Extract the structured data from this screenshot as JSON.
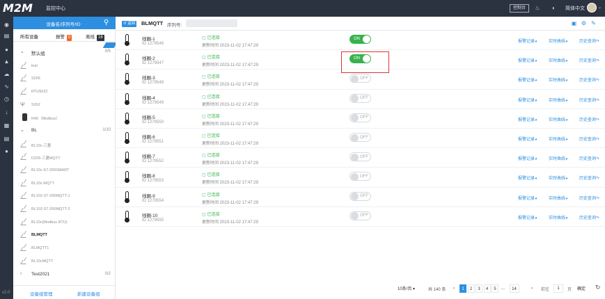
{
  "topbar": {
    "logo": "M2M",
    "title": "监控中心",
    "console_button": "控制台",
    "language": "简体中文"
  },
  "rail": {
    "icons": [
      "home-icon",
      "monitor-icon",
      "location-icon",
      "bell-icon",
      "cloud-icon",
      "signal-icon",
      "clock-icon",
      "download-icon",
      "calendar-icon",
      "list-icon",
      "user-icon"
    ],
    "version": "v2.0"
  },
  "devices": {
    "search_placeholder": "设备名/序列号/ID",
    "tabs": {
      "all": "所有设备",
      "alarm": "报警",
      "alarm_count": "0",
      "offline": "离线",
      "offline_count": "16"
    },
    "groups": [
      {
        "name": "默认组",
        "count": "0/5",
        "expanded": true,
        "items": [
          "test",
          "S265",
          "RTU5022",
          "S262",
          "R40（Modbus）"
        ]
      },
      {
        "name": "BL",
        "count": "1/10",
        "expanded": true,
        "items": [
          "BL10c-三菱",
          "D225-三菱MQTT",
          "BL10c-S7-200SMART",
          "BL10c-MQTT",
          "BL102-S7-200MQTT-1",
          "BL102-S7-200MQTT-2",
          "BL10c(Modbus RTU)",
          "BLMQTT",
          "BLMQTT1",
          "BL10cMQTT"
        ]
      },
      {
        "name": "Test2021",
        "count": "0/2",
        "expanded": false,
        "items": []
      }
    ],
    "active_item": "BLMQTT",
    "manage_groups": "设备组管理",
    "new_group": "新建设备组"
  },
  "main": {
    "back": "返回",
    "title": "BLMQTT",
    "serial_label": "序列号:",
    "status_text": "已连接",
    "time_text": "更新时间 2023-11-02 17:47:29",
    "links": {
      "alarm": "报警记录",
      "realtime": "实时曲线",
      "history": "历史查询"
    },
    "rows": [
      {
        "name": "线圈-1",
        "id": "ID 1279546",
        "state": "ON"
      },
      {
        "name": "线圈-2",
        "id": "ID 1279547",
        "state": "ON"
      },
      {
        "name": "线圈-3",
        "id": "ID 1279548",
        "state": "OFF"
      },
      {
        "name": "线圈-4",
        "id": "ID 1279549",
        "state": "OFF"
      },
      {
        "name": "线圈-5",
        "id": "ID 1279550",
        "state": "OFF"
      },
      {
        "name": "线圈-6",
        "id": "ID 1279551",
        "state": "OFF"
      },
      {
        "name": "线圈-7",
        "id": "ID 1279552",
        "state": "OFF"
      },
      {
        "name": "线圈-8",
        "id": "ID 1279553",
        "state": "OFF"
      },
      {
        "name": "线圈-9",
        "id": "ID 1279554",
        "state": "OFF"
      },
      {
        "name": "线圈-10",
        "id": "ID 1279555",
        "state": "OFF"
      }
    ]
  },
  "pagination": {
    "page_size": "10条/页",
    "total": "共 140 条",
    "pages": [
      "1",
      "2",
      "3",
      "4",
      "5",
      "...",
      "14"
    ],
    "current": "1",
    "goto_label": "前往",
    "goto_value": "1",
    "page_unit": "页",
    "confirm": "确定"
  },
  "colors": {
    "dark": "#2b3340",
    "accent": "#2e8fe0",
    "on": "#37b24d",
    "highlight": "#e03131"
  }
}
